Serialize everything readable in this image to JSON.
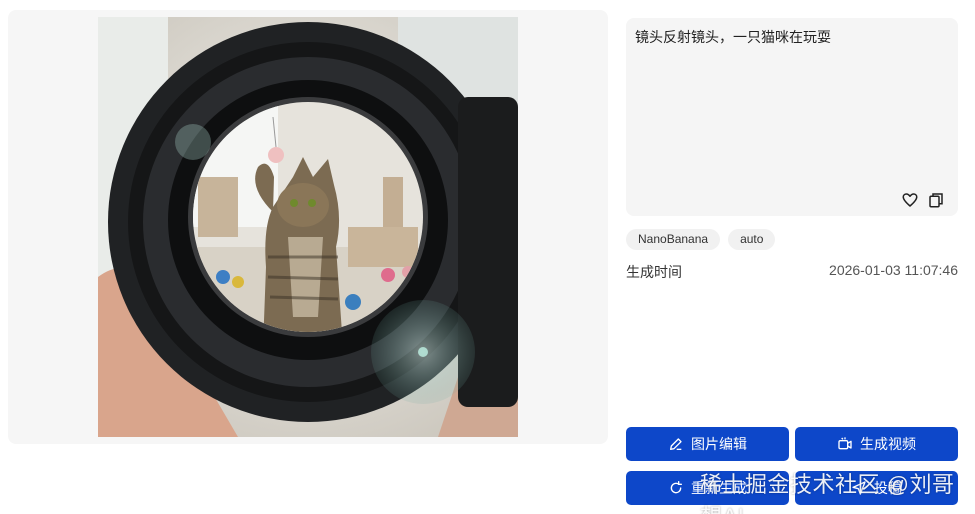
{
  "prompt": {
    "text": "镜头反射镜头，一只猫咪在玩耍",
    "icons": [
      "heart-icon",
      "copy-icon"
    ]
  },
  "tags": [
    "NanoBanana",
    "auto"
  ],
  "generation": {
    "label": "生成时间",
    "time": "2026-01-03 11:07:46"
  },
  "actions": {
    "edit_label": "图片编辑",
    "video_label": "生成视频",
    "redo_label": "重新生成",
    "submit_label": "投稿"
  },
  "watermark": "稀土掘金技术社区 @刘哥想AI",
  "colors": {
    "primary_button": "#0d47c9",
    "panel_bg": "#f5f5f5"
  }
}
